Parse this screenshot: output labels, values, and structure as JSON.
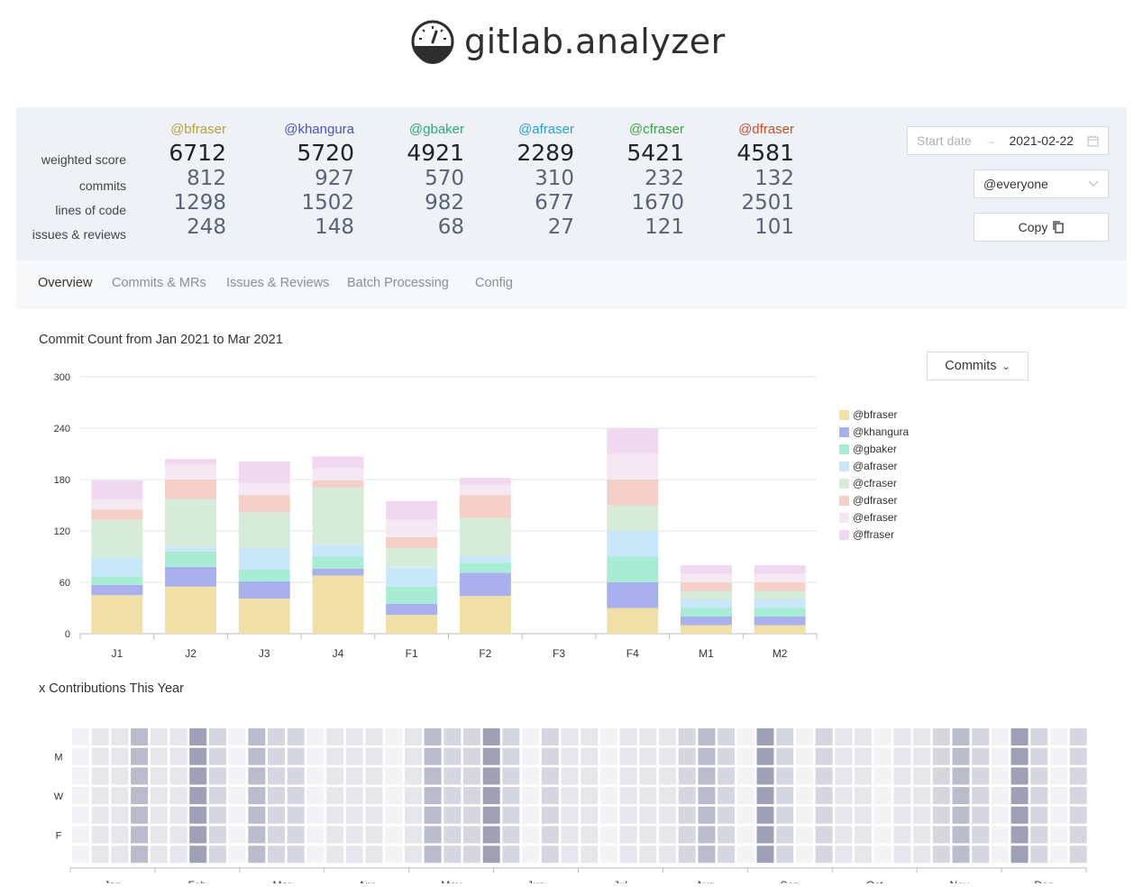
{
  "app": {
    "title": "gitlab.analyzer"
  },
  "stats": {
    "row_labels": [
      "weighted score",
      "commits",
      "lines of code",
      "issues & reviews"
    ],
    "users": [
      {
        "handle": "@bfraser",
        "color": "#b8a040",
        "score": "6712",
        "commits": "812",
        "loc": "1298",
        "issues": "248"
      },
      {
        "handle": "@khangura",
        "color": "#4a54b8",
        "score": "5720",
        "commits": "927",
        "loc": "1502",
        "issues": "148"
      },
      {
        "handle": "@gbaker",
        "color": "#2aa876",
        "score": "4921",
        "commits": "570",
        "loc": "982",
        "issues": "68"
      },
      {
        "handle": "@afraser",
        "color": "#2a9fd6",
        "score": "2289",
        "commits": "310",
        "loc": "677",
        "issues": "27"
      },
      {
        "handle": "@cfraser",
        "color": "#3ea048",
        "score": "5421",
        "commits": "232",
        "loc": "1670",
        "issues": "121"
      },
      {
        "handle": "@dfraser",
        "color": "#c4502e",
        "score": "4581",
        "commits": "132",
        "loc": "2501",
        "issues": "101"
      }
    ]
  },
  "controls": {
    "start_placeholder": "Start date",
    "end_date": "2021-02-22",
    "user_filter": "@everyone",
    "copy_label": "Copy"
  },
  "tabs": [
    "Overview",
    "Commits & MRs",
    "Issues & Reviews",
    "Batch Processing",
    "Config"
  ],
  "chart": {
    "title": "Commit Count from Jan 2021 to Mar 2021",
    "mode_label": "Commits"
  },
  "chart_data": {
    "type": "bar",
    "stacked": true,
    "categories": [
      "J1",
      "J2",
      "J3",
      "J4",
      "F1",
      "F2",
      "F3",
      "F4",
      "M1",
      "M2"
    ],
    "ylim": [
      0,
      300
    ],
    "yticks": [
      0,
      60,
      120,
      180,
      240,
      300
    ],
    "grid": true,
    "legend_position": "right",
    "series": [
      {
        "name": "@bfraser",
        "color": "#f0e0a8",
        "values": [
          45,
          55,
          41,
          68,
          22,
          44,
          0,
          30,
          10,
          10
        ]
      },
      {
        "name": "@khangura",
        "color": "#aab0ec",
        "values": [
          12,
          23,
          20,
          8,
          13,
          27,
          0,
          30,
          10,
          10
        ]
      },
      {
        "name": "@gbaker",
        "color": "#a8ecd6",
        "values": [
          10,
          18,
          14,
          14,
          20,
          12,
          0,
          30,
          10,
          10
        ]
      },
      {
        "name": "@afraser",
        "color": "#c8e8fa",
        "values": [
          22,
          6,
          25,
          14,
          22,
          8,
          0,
          30,
          10,
          10
        ]
      },
      {
        "name": "@cfraser",
        "color": "#d6ecd8",
        "values": [
          44,
          55,
          42,
          67,
          23,
          44,
          0,
          30,
          10,
          10
        ]
      },
      {
        "name": "@dfraser",
        "color": "#f4d0c8",
        "values": [
          12,
          23,
          20,
          8,
          13,
          27,
          0,
          30,
          10,
          10
        ]
      },
      {
        "name": "@efraser",
        "color": "#f5e8f2",
        "values": [
          12,
          18,
          14,
          14,
          20,
          12,
          0,
          30,
          10,
          10
        ]
      },
      {
        "name": "@ffraser",
        "color": "#f0d8f0",
        "values": [
          22,
          6,
          25,
          14,
          22,
          8,
          0,
          30,
          10,
          10
        ]
      }
    ]
  },
  "heatmap": {
    "title": "x Contributions This Year",
    "day_labels": [
      "M",
      "W",
      "F"
    ],
    "months": [
      "Jan",
      "Feb",
      "Mar",
      "Apr",
      "May",
      "Jun",
      "Jul",
      "Aug",
      "Sep",
      "Oct",
      "Nov",
      "Dec"
    ],
    "week_levels": [
      0,
      1,
      1,
      3,
      1,
      1,
      4,
      2,
      0,
      3,
      2,
      2,
      0,
      1,
      1,
      1,
      0,
      1,
      3,
      2,
      2,
      4,
      2,
      0,
      2,
      1,
      1,
      0,
      1,
      1,
      1,
      2,
      3,
      2,
      0,
      4,
      2,
      0,
      2,
      1,
      1,
      0,
      1,
      1,
      2,
      3,
      2,
      0,
      4,
      2,
      0,
      2
    ],
    "level_colors": [
      "#f3f3f5",
      "#e6e6ec",
      "#d5d6e0",
      "#babccb",
      "#9ea1b6"
    ]
  }
}
